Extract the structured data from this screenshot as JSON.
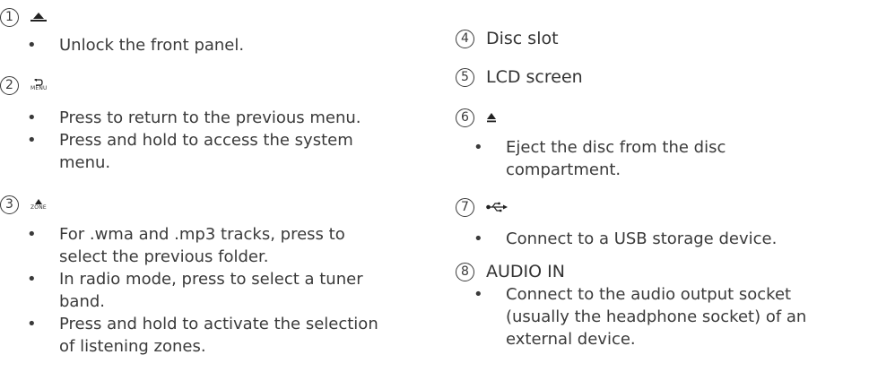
{
  "items": [
    {
      "number": "1",
      "icon": "unlock-icon",
      "bullets": [
        "Unlock the front panel."
      ]
    },
    {
      "number": "2",
      "icon": "back-menu-icon",
      "icon_label": "MENU",
      "bullets": [
        "Press to return to the previous menu.",
        "Press and hold to access the system menu."
      ]
    },
    {
      "number": "3",
      "icon": "zone-up-icon",
      "icon_label": "ZONE",
      "bullets": [
        "For .wma and .mp3 tracks, press to select the previous folder.",
        "In radio mode, press to select a tuner band.",
        "Press and hold to activate the selection of listening zones."
      ]
    },
    {
      "number": "4",
      "title": "Disc slot"
    },
    {
      "number": "5",
      "title": "LCD screen"
    },
    {
      "number": "6",
      "icon": "eject-icon",
      "bullets": [
        "Eject the disc from the disc compartment."
      ]
    },
    {
      "number": "7",
      "icon": "usb-icon",
      "bullets": [
        "Connect to a USB storage device."
      ]
    },
    {
      "number": "8",
      "title": "AUDIO IN",
      "bullets": [
        "Connect to the audio output socket (usually the headphone socket) of an external device."
      ]
    }
  ]
}
